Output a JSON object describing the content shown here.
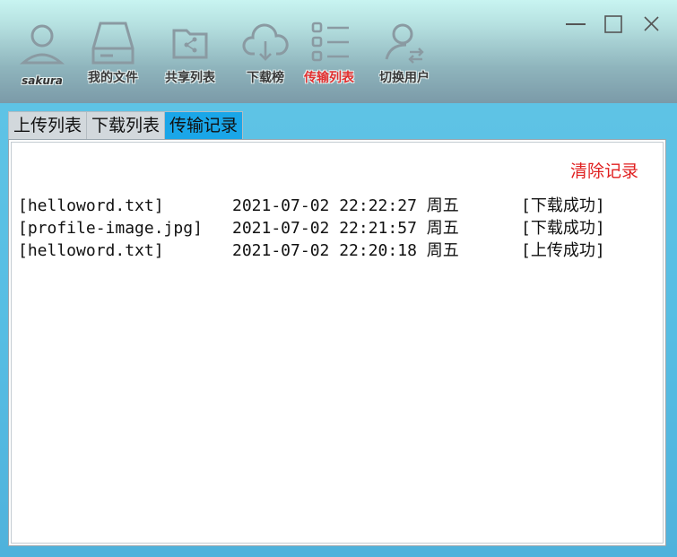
{
  "window": {
    "minimize_icon": "minimize-icon",
    "maximize_icon": "maximize-icon",
    "close_icon": "close-icon"
  },
  "user": {
    "name": "sakura",
    "icon": "user-avatar-icon"
  },
  "toolbar": {
    "items": [
      {
        "label": "我的文件",
        "icon": "drive-icon",
        "active": false
      },
      {
        "label": "共享列表",
        "icon": "shared-folder-icon",
        "active": false
      },
      {
        "label": "下载榜",
        "icon": "cloud-download-icon",
        "active": false
      },
      {
        "label": "传输列表",
        "icon": "list-icon",
        "active": true
      },
      {
        "label": "切换用户",
        "icon": "switch-user-icon",
        "active": false
      }
    ]
  },
  "tabs": [
    {
      "label": "上传列表",
      "active": false
    },
    {
      "label": "下载列表",
      "active": false
    },
    {
      "label": "传输记录",
      "active": true
    }
  ],
  "panel": {
    "clear_label": "清除记录",
    "records": [
      {
        "file": "[helloword.txt]",
        "time": "2021-07-02 22:22:27 周五",
        "status": "[下载成功]"
      },
      {
        "file": "[profile-image.jpg]",
        "time": "2021-07-02 22:21:57 周五",
        "status": "[下载成功]"
      },
      {
        "file": "[helloword.txt]",
        "time": "2021-07-02 22:20:18 周五",
        "status": "[上传成功]"
      }
    ]
  },
  "colors": {
    "active_tab": "#1aa6e8",
    "active_toolbar_label": "#e23030",
    "clear_button": "#e02020",
    "body_background": "#56bde3"
  }
}
